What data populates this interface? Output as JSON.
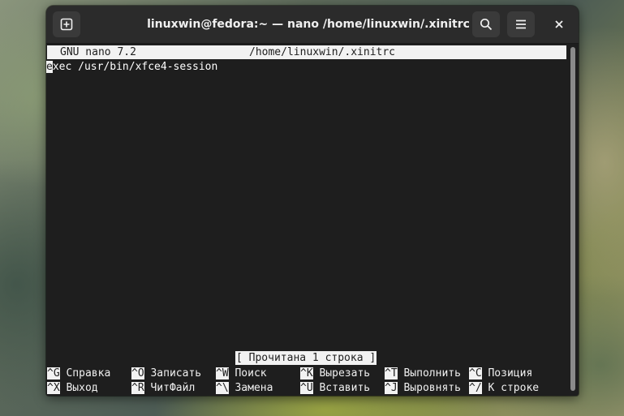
{
  "window": {
    "title": "linuxwin@fedora:~ — nano /home/linuxwin/.xinitrc",
    "buttons": [
      "new-tab-icon",
      "search-icon",
      "menu-icon",
      "close-icon"
    ]
  },
  "nano": {
    "version": "GNU nano 7.2",
    "filename": "/home/linuxwin/.xinitrc",
    "cursor_char": "e",
    "line1_rest": "xec /usr/bin/xfce4-session",
    "status": "[ Прочитана 1 строка ]"
  },
  "shortcuts": {
    "row1": [
      {
        "key": "^G",
        "label": "Справка"
      },
      {
        "key": "^O",
        "label": "Записать"
      },
      {
        "key": "^W",
        "label": "Поиск"
      },
      {
        "key": "^K",
        "label": "Вырезать"
      },
      {
        "key": "^T",
        "label": "Выполнить"
      },
      {
        "key": "^C",
        "label": "Позиция"
      }
    ],
    "row2": [
      {
        "key": "^X",
        "label": "Выход"
      },
      {
        "key": "^R",
        "label": "ЧитФайл"
      },
      {
        "key": "^\\",
        "label": "Замена"
      },
      {
        "key": "^U",
        "label": "Вставить"
      },
      {
        "key": "^J",
        "label": "Выровнять"
      },
      {
        "key": "^/",
        "label": "К строке"
      }
    ]
  },
  "colors": {
    "terminal_bg": "#1e1e1e",
    "titlebar_bg": "#2b2b2b",
    "inverse_bg": "#f2f2f2"
  }
}
